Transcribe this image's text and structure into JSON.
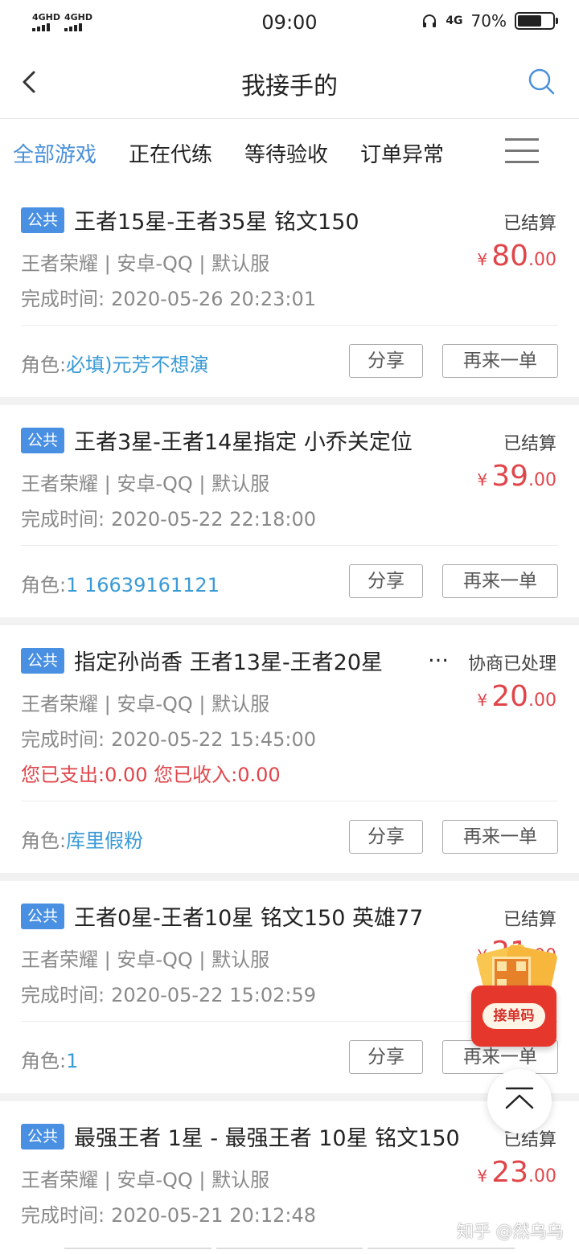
{
  "status_bar": {
    "signal1": "4GHD",
    "signal2": "4GHD",
    "time": "09:00",
    "network": "4G",
    "battery": "70%",
    "battery_level": 0.7
  },
  "header": {
    "title": "我接手的"
  },
  "tabs": [
    {
      "label": "全部游戏",
      "active": true
    },
    {
      "label": "正在代练",
      "active": false
    },
    {
      "label": "等待验收",
      "active": false
    },
    {
      "label": "订单异常",
      "active": false
    }
  ],
  "orders": [
    {
      "badge": "公共",
      "title": "王者15星-王者35星 铭文150",
      "status": "已结算",
      "currency": "¥",
      "price_int": "80",
      "price_dec": ".00",
      "meta": "王者荣耀 | 安卓-QQ | 默认服",
      "time_label": "完成时间:",
      "time": "2020-05-26 20:23:01",
      "role_label": "角色:",
      "role": "必填)元芳不想演",
      "share": "分享",
      "again": "再来一单"
    },
    {
      "badge": "公共",
      "title": "王者3星-王者14星指定 小乔关定位",
      "status": "已结算",
      "currency": "¥",
      "price_int": "39",
      "price_dec": ".00",
      "meta": "王者荣耀 | 安卓-QQ | 默认服",
      "time_label": "完成时间:",
      "time": "2020-05-22 22:18:00",
      "role_label": "角色:",
      "role": "1 16639161121",
      "share": "分享",
      "again": "再来一单"
    },
    {
      "badge": "公共",
      "title": "指定孙尚香 王者13星-王者20星",
      "more": "…",
      "status": "协商已处理",
      "currency": "¥",
      "price_int": "20",
      "price_dec": ".00",
      "meta": "王者荣耀 | 安卓-QQ | 默认服",
      "time_label": "完成时间:",
      "time": "2020-05-22 15:45:00",
      "money": "您已支出:0.00 您已收入:0.00",
      "role_label": "角色:",
      "role": "库里假粉",
      "share": "分享",
      "again": "再来一单"
    },
    {
      "badge": "公共",
      "title": "王者0星-王者10星 铭文150 英雄77",
      "status": "已结算",
      "currency": "¥",
      "price_int": "21",
      "price_dec": ".00",
      "meta": "王者荣耀 | 安卓-QQ | 默认服",
      "time_label": "完成时间:",
      "time": "2020-05-22 15:02:59",
      "role_label": "角色:",
      "role": "1",
      "share": "分享",
      "again": "再来一单"
    },
    {
      "badge": "公共",
      "title": "最强王者 1星 - 最强王者 10星 铭文150",
      "status": "已结算",
      "currency": "¥",
      "price_int": "23",
      "price_dec": ".00",
      "meta": "王者荣耀 | 安卓-QQ | 默认服",
      "time_label": "完成时间:",
      "time": "2020-05-21 20:12:48"
    }
  ],
  "floating": {
    "label": "接单码"
  },
  "watermark": "知乎 @然乌乌",
  "colors": {
    "accent": "#4a90d9",
    "price": "#e0454a",
    "role": "#3a9ad6",
    "badge": "#4a90e2"
  }
}
